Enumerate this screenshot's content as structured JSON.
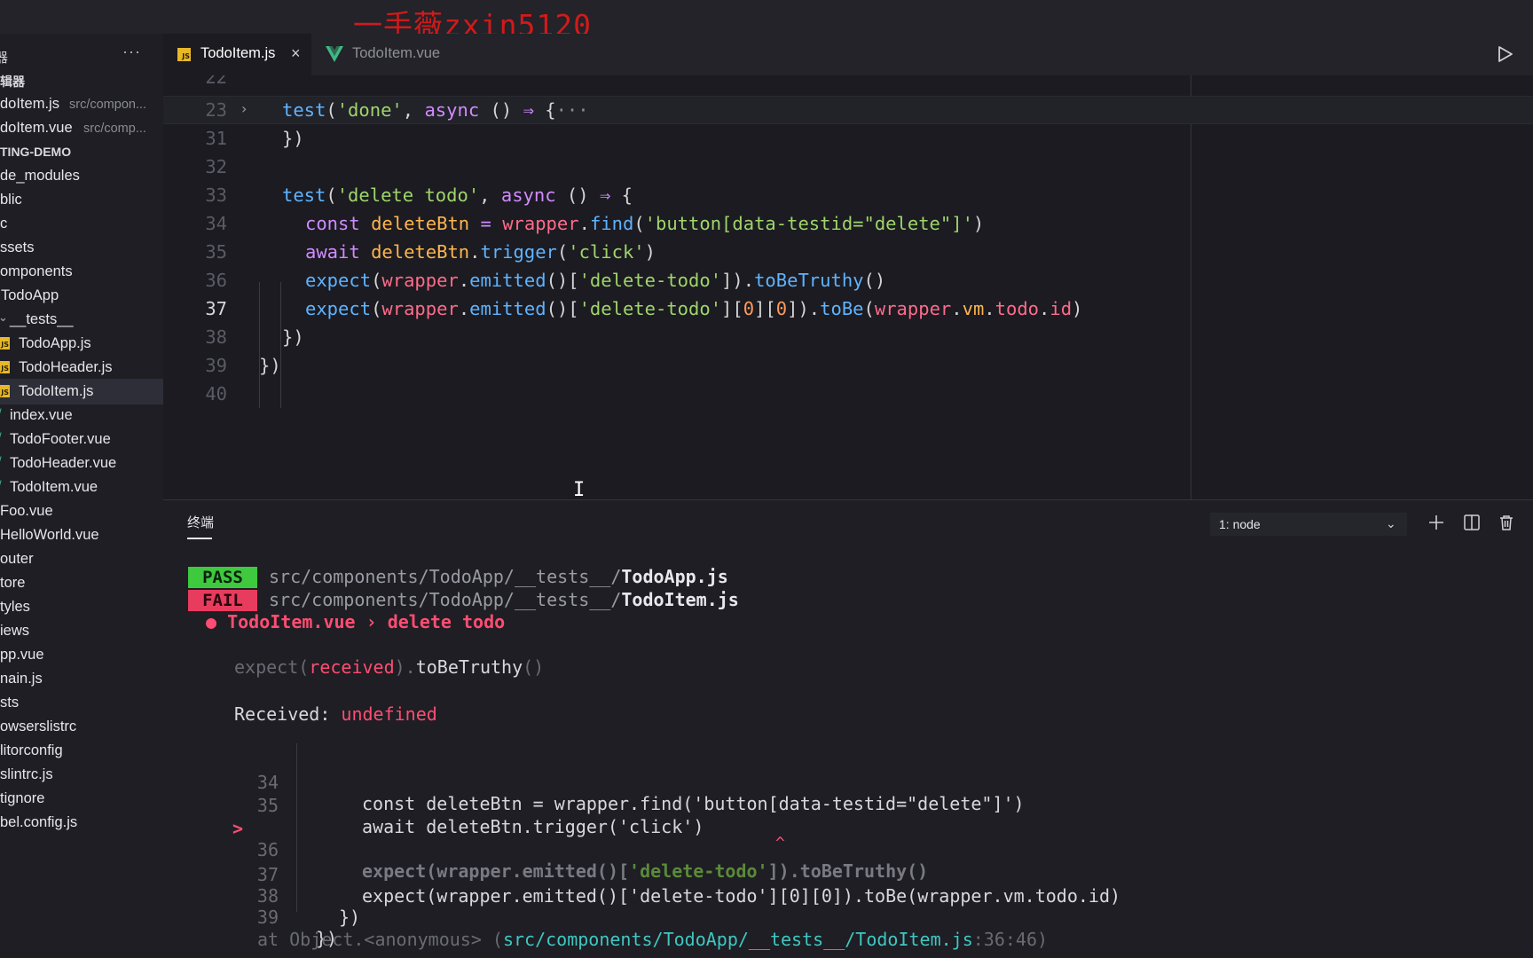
{
  "watermark": "一手薇zxin5120",
  "sidebar": {
    "header": "器",
    "more": "···",
    "items": [
      {
        "label": "辑器",
        "sub": "",
        "type": "section"
      },
      {
        "label": "doItem.js",
        "sub": "src/compon...",
        "type": "open"
      },
      {
        "label": "doItem.vue",
        "sub": "src/comp...",
        "type": "open"
      },
      {
        "label": "TING-DEMO",
        "sub": "",
        "type": "section"
      },
      {
        "label": "de_modules",
        "sub": "",
        "type": "folder"
      },
      {
        "label": "blic",
        "sub": "",
        "type": "folder"
      },
      {
        "label": "c",
        "sub": "",
        "type": "folder"
      },
      {
        "label": "ssets",
        "sub": "",
        "type": "folder"
      },
      {
        "label": "omponents",
        "sub": "",
        "type": "folder"
      },
      {
        "label": "TodoApp",
        "sub": "",
        "type": "folder"
      },
      {
        "label": "__tests__",
        "sub": "",
        "type": "folder-open"
      },
      {
        "label": "TodoApp.js",
        "sub": "",
        "type": "js"
      },
      {
        "label": "TodoHeader.js",
        "sub": "",
        "type": "js"
      },
      {
        "label": "TodoItem.js",
        "sub": "",
        "type": "js-selected"
      },
      {
        "label": "index.vue",
        "sub": "",
        "type": "vue"
      },
      {
        "label": "TodoFooter.vue",
        "sub": "",
        "type": "vue"
      },
      {
        "label": "TodoHeader.vue",
        "sub": "",
        "type": "vue"
      },
      {
        "label": "TodoItem.vue",
        "sub": "",
        "type": "vue"
      },
      {
        "label": "Foo.vue",
        "sub": "",
        "type": "file"
      },
      {
        "label": "HelloWorld.vue",
        "sub": "",
        "type": "file"
      },
      {
        "label": "outer",
        "sub": "",
        "type": "folder"
      },
      {
        "label": "tore",
        "sub": "",
        "type": "folder"
      },
      {
        "label": "tyles",
        "sub": "",
        "type": "folder"
      },
      {
        "label": "iews",
        "sub": "",
        "type": "folder"
      },
      {
        "label": "pp.vue",
        "sub": "",
        "type": "file"
      },
      {
        "label": "nain.js",
        "sub": "",
        "type": "file"
      },
      {
        "label": "sts",
        "sub": "",
        "type": "folder"
      },
      {
        "label": "owserslistrc",
        "sub": "",
        "type": "file"
      },
      {
        "label": "litorconfig",
        "sub": "",
        "type": "file"
      },
      {
        "label": "slintrc.js",
        "sub": "",
        "type": "file"
      },
      {
        "label": "tignore",
        "sub": "",
        "type": "file"
      },
      {
        "label": "bel.config.js",
        "sub": "",
        "type": "file"
      }
    ]
  },
  "tabs": [
    {
      "label": "TodoItem.js",
      "active": true,
      "icon": "js-file-icon"
    },
    {
      "label": "TodoItem.vue",
      "active": false,
      "icon": "vue-file-icon"
    }
  ],
  "editor": {
    "line_numbers": {
      "l22": "22",
      "l23": "23",
      "l31": "31",
      "l32": "32",
      "l33": "33",
      "l34": "34",
      "l35": "35",
      "l36": "36",
      "l37": "37",
      "l38": "38",
      "l39": "39",
      "l40": "40"
    },
    "current_line": "37",
    "ellipsis": "···"
  },
  "terminal": {
    "tab_label": "终端",
    "shell_select": "1: node",
    "results": [
      {
        "status": "PASS",
        "path": "src/components/TodoApp/__tests__/",
        "file": "TodoApp.js"
      },
      {
        "status": "FAIL",
        "path": "src/components/TodoApp/__tests__/",
        "file": "TodoItem.js"
      }
    ],
    "failed_test": "● TodoItem.vue › delete todo",
    "received_label": "Received: ",
    "received_value": "undefined",
    "snippet_lines": {
      "n34": "34",
      "n35": "35",
      "n36": "36",
      "n37": "37",
      "n38": "38",
      "n39": "39"
    },
    "marker": ">",
    "caret": "^",
    "stack_prefix": "at Object.<anonymous> (",
    "stack_path": "src/components/TodoApp/__tests__/TodoItem.js",
    "stack_pos": ":36:46)"
  },
  "colors": {
    "pass": "#3ec93e",
    "fail": "#e73c5e",
    "js_badge": "#e8b82a",
    "vue_green": "#41b883"
  }
}
